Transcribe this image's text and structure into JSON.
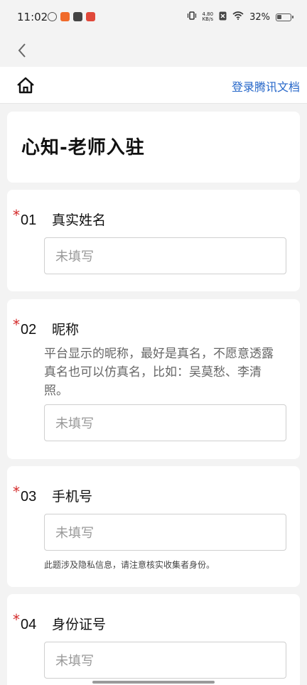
{
  "status_bar": {
    "time": "11:02",
    "net_speed_value": "4.80",
    "net_speed_unit": "KB/s",
    "battery": "32%"
  },
  "header": {
    "login_link": "登录腾讯文档"
  },
  "form": {
    "title": "心知-老师入驻",
    "required_mark": "*",
    "questions": [
      {
        "number": "01",
        "title": "真实姓名",
        "placeholder": "未填写"
      },
      {
        "number": "02",
        "title": "昵称",
        "description": "平台显示的昵称，最好是真名，不愿意透露真名也可以仿真名，比如：吴莫愁、李清照。",
        "placeholder": "未填写"
      },
      {
        "number": "03",
        "title": "手机号",
        "placeholder": "未填写",
        "note": "此题涉及隐私信息，请注意核实收集者身份。"
      },
      {
        "number": "04",
        "title": "身份证号",
        "placeholder": "未填写"
      }
    ]
  },
  "colors": {
    "accent_link": "#2667c9",
    "required": "#d42a2a",
    "background": "#f3f3f3"
  },
  "icons": [
    "back-chevron-icon",
    "home-icon",
    "signal-icon",
    "wifi-icon",
    "battery-icon"
  ]
}
